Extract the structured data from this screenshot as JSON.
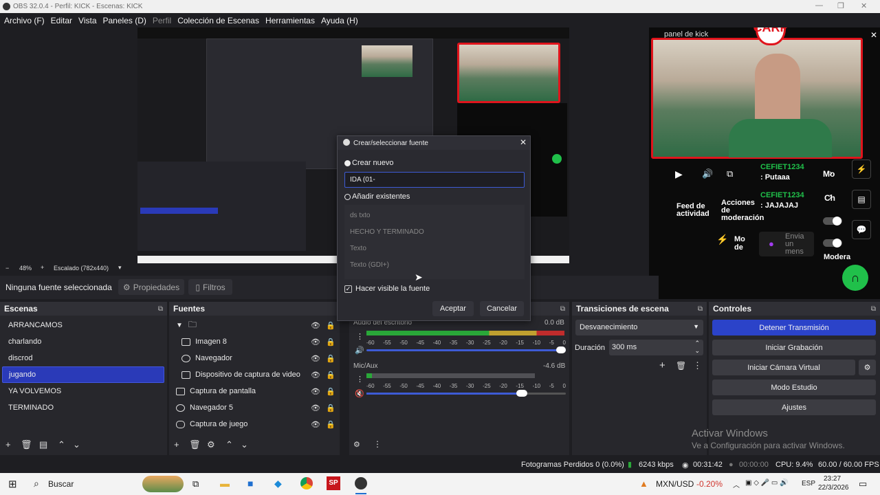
{
  "window": {
    "title": "OBS 32.0.4 - Perfil: KICK - Escenas: KICK",
    "min": "—",
    "max": "❐",
    "close": "✕"
  },
  "menu": [
    "Archivo (F)",
    "Editar",
    "Vista",
    "Paneles (D)",
    "Perfil",
    "Colección de Escenas",
    "Herramientas",
    "Ayuda (H)"
  ],
  "preview": {
    "zoom_minus": "−",
    "zoom": "48%",
    "zoom_plus": "+",
    "scaled": "Escalado (782x440)"
  },
  "kick_panel": {
    "title": "panel de kick",
    "chat": [
      {
        "user": "CEFIET1234",
        "msg": ": Putaaa"
      },
      {
        "user": "CEFIET1234",
        "msg": ": JAJAJAJ"
      }
    ],
    "labels": {
      "mo": "Mo",
      "ch": "Ch",
      "feed": "Feed de actividad",
      "acciones": "Acciones de moderación",
      "md": "Mo de",
      "envia": "Envia un mens",
      "modera": "Modera"
    }
  },
  "props_bar": {
    "no_source": "Ninguna fuente seleccionada",
    "properties": "Propiedades",
    "filters": "Filtros"
  },
  "scenes": {
    "title": "Escenas",
    "items": [
      "ARRANCAMOS",
      "charlando",
      "discrod",
      "jugando",
      "YA VOLVEMOS",
      "TERMINADO"
    ],
    "selected": 3
  },
  "sources": {
    "title": "Fuentes",
    "items": [
      {
        "label": "",
        "indent": 1,
        "icon": "folder-icon"
      },
      {
        "label": "Imagen 8",
        "indent": 2,
        "icon": "image-icon"
      },
      {
        "label": "Navegador",
        "indent": 2,
        "icon": "globe-icon"
      },
      {
        "label": "Dispositivo de captura de video",
        "indent": 2,
        "icon": "camera-icon"
      },
      {
        "label": "Captura de pantalla",
        "indent": 0,
        "icon": "monitor-icon"
      },
      {
        "label": "Navegador 5",
        "indent": 0,
        "icon": "globe-icon"
      },
      {
        "label": "Captura de juego",
        "indent": 0,
        "icon": "gamepad-icon"
      }
    ]
  },
  "mixer": {
    "channels": [
      {
        "name": "Audio del escritorio",
        "db": "0.0 dB",
        "level": 0.95,
        "volume": 1.0
      },
      {
        "name": "Mic/Aux",
        "db": "-4.6 dB",
        "level": 0.05,
        "volume": 0.78
      }
    ],
    "ticks": [
      "-60",
      "-55",
      "-50",
      "-45",
      "-40",
      "-35",
      "-30",
      "-25",
      "-20",
      "-15",
      "-10",
      "-5",
      "0"
    ]
  },
  "transitions": {
    "title": "Transiciones de escena",
    "type": "Desvanecimiento",
    "duration_label": "Duración",
    "duration": "300 ms"
  },
  "controls": {
    "title": "Controles",
    "buttons": [
      "Detener Transmisión",
      "Iniciar Grabación",
      "Iniciar Cámara Virtual",
      "Modo Estudio",
      "Ajustes"
    ]
  },
  "dialog": {
    "title": "Crear/seleccionar fuente",
    "create_new": "Crear nuevo",
    "name_value": "IDA (01-",
    "add_existing": "Añadir existentes",
    "existing": [
      "ds txto",
      "HECHO Y TERMINADO",
      "Texto",
      "Texto (GDI+)"
    ],
    "make_visible": "Hacer visible la fuente",
    "accept": "Aceptar",
    "cancel": "Cancelar"
  },
  "watermark": {
    "line1": "Activar Windows",
    "line2": "Ve a Configuración para activar Windows."
  },
  "status": {
    "dropped": "Fotogramas Perdidos 0 (0.0%)",
    "bitrate": "6243 kbps",
    "stream_time": "00:31:42",
    "rec_time": "00:00:00",
    "cpu": "CPU: 9.4%",
    "fps": "60.00 / 60.00 FPS"
  },
  "taskbar": {
    "search": "Buscar",
    "ticker": "MXN/USD",
    "change": "-0.20%",
    "lang": "ESP",
    "time": "23:27",
    "date": "22/3/2026"
  },
  "colors": {
    "accent": "#2b43c9",
    "kick_red": "#e0141c",
    "kick_green": "#20c04a",
    "negative": "#d0342c"
  }
}
